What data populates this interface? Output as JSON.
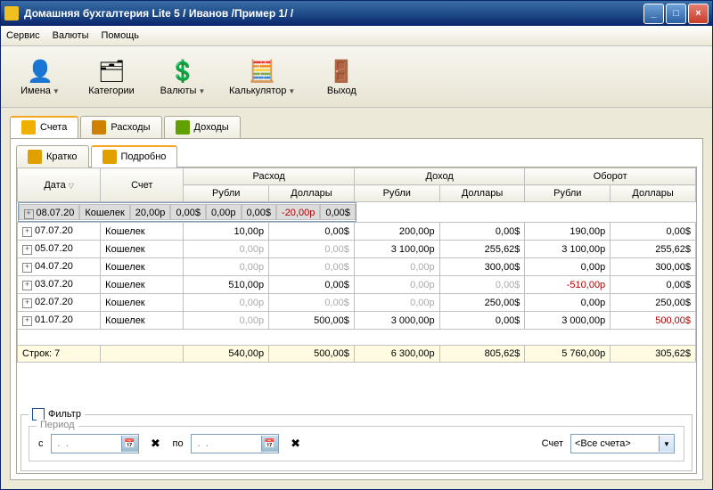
{
  "window": {
    "title": "Домашняя бухгалтерия Lite 5  / Иванов /Пример 1/ /"
  },
  "menu": {
    "items": [
      "Сервис",
      "Валюты",
      "Помощь"
    ]
  },
  "toolbar": {
    "items": [
      {
        "label": "Имена",
        "arrow": true,
        "icon": "👤",
        "name": "names-button"
      },
      {
        "label": "Категории",
        "arrow": false,
        "icon": "🗂",
        "name": "categories-button"
      },
      {
        "label": "Валюты",
        "arrow": true,
        "icon": "💲",
        "name": "currencies-button"
      },
      {
        "label": "Калькулятор",
        "arrow": true,
        "icon": "🧮",
        "name": "calculator-button"
      },
      {
        "label": "Выход",
        "arrow": false,
        "icon": "🚪",
        "name": "exit-button"
      }
    ]
  },
  "mainTabs": {
    "items": [
      {
        "label": "Счета",
        "color": "#f0b000"
      },
      {
        "label": "Расходы",
        "color": "#d08000"
      },
      {
        "label": "Доходы",
        "color": "#60a000"
      }
    ],
    "active": 0
  },
  "subTabs": {
    "items": [
      {
        "label": "Кратко"
      },
      {
        "label": "Подробно"
      }
    ],
    "active": 1
  },
  "grid": {
    "headers": {
      "date": "Дата",
      "account": "Счет",
      "expense": "Расход",
      "income": "Доход",
      "turnover": "Оборот",
      "rub": "Рубли",
      "usd": "Доллары"
    },
    "rows": [
      {
        "date": "08.07.20",
        "acct": "Кошелек",
        "er": "20,00р",
        "eu": "0,00$",
        "ir": "0,00р",
        "iu": "0,00$",
        "tr": "-20,00р",
        "tu": "0,00$",
        "sel": true,
        "trneg": true
      },
      {
        "date": "07.07.20",
        "acct": "Кошелек",
        "er": "10,00р",
        "eu": "0,00$",
        "ir": "200,00р",
        "iu": "0,00$",
        "tr": "190,00р",
        "tu": "0,00$"
      },
      {
        "date": "05.07.20",
        "acct": "Кошелек",
        "er": "0,00р",
        "eu": "0,00$",
        "ir": "3 100,00р",
        "iu": "255,62$",
        "tr": "3 100,00р",
        "tu": "255,62$",
        "grayexp": true
      },
      {
        "date": "04.07.20",
        "acct": "Кошелек",
        "er": "0,00р",
        "eu": "0,00$",
        "ir": "0,00р",
        "iu": "300,00$",
        "tr": "0,00р",
        "tu": "300,00$",
        "grayexp": true,
        "grayir": true
      },
      {
        "date": "03.07.20",
        "acct": "Кошелек",
        "er": "510,00р",
        "eu": "0,00$",
        "ir": "0,00р",
        "iu": "0,00$",
        "tr": "-510,00р",
        "tu": "0,00$",
        "trneg": true,
        "grayinc": true
      },
      {
        "date": "02.07.20",
        "acct": "Кошелек",
        "er": "0,00р",
        "eu": "0,00$",
        "ir": "0,00р",
        "iu": "250,00$",
        "tr": "0,00р",
        "tu": "250,00$",
        "grayexp": true,
        "grayir": true
      },
      {
        "date": "01.07.20",
        "acct": "Кошелек",
        "er": "0,00р",
        "eu": "500,00$",
        "ir": "3 000,00р",
        "iu": "0,00$",
        "tr": "3 000,00р",
        "tu": "500,00$",
        "grayexp_r": true,
        "tuneg": true
      }
    ],
    "totals": {
      "label": "Строк: 7",
      "er": "540,00р",
      "eu": "500,00$",
      "ir": "6 300,00р",
      "iu": "805,62$",
      "tr": "5 760,00р",
      "tu": "305,62$"
    }
  },
  "filter": {
    "title": "Фильтр",
    "period": {
      "legend": "Период",
      "from": "с",
      "to": "по",
      "placeholder": " .  . "
    },
    "accountLabel": "Счет",
    "accountValue": "<Все счета>"
  }
}
